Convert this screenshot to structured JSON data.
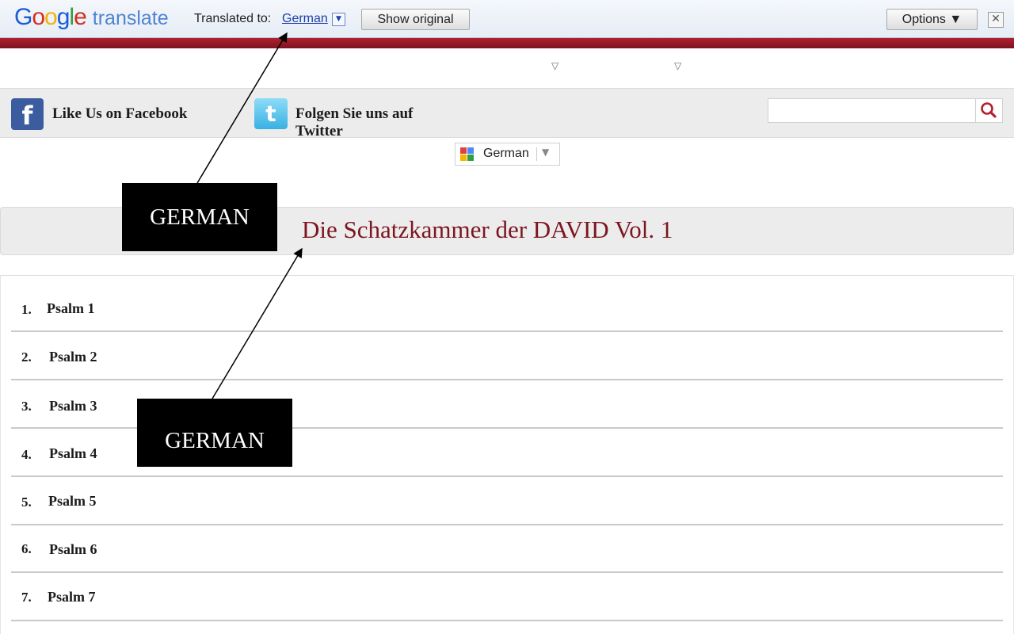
{
  "translate_bar": {
    "logo_google": "Google",
    "logo_translate": "translate",
    "translated_to_label": "Translated to:",
    "language": "German",
    "language_dropdown_glyph": "▼",
    "show_original": "Show original",
    "options": "Options ▼",
    "close_glyph": "✕"
  },
  "nav": {
    "dropdown_glyph": "▽"
  },
  "social": {
    "facebook_label": "Like Us on Facebook",
    "facebook_icon": "facebook-icon",
    "twitter_label": "Folgen Sie uns auf Twitter",
    "twitter_icon": "twitter-icon",
    "search_placeholder": "",
    "search_icon": "search-icon"
  },
  "language_widget": {
    "label": "German",
    "arrow": "▼"
  },
  "page": {
    "title": "Die Schatzkammer der DAVID Vol. 1"
  },
  "psalms": [
    {
      "num": "1.",
      "label": "Psalm 1"
    },
    {
      "num": "2.",
      "label": "Psalm 2"
    },
    {
      "num": "3.",
      "label": "Psalm 3"
    },
    {
      "num": "4.",
      "label": "Psalm 4"
    },
    {
      "num": "5.",
      "label": "Psalm 5"
    },
    {
      "num": "6.",
      "label": "Psalm 6"
    },
    {
      "num": "7.",
      "label": "Psalm 7"
    }
  ],
  "annotations": [
    {
      "text": "GERMAN"
    },
    {
      "text": "GERMAN"
    }
  ],
  "colors": {
    "title": "#7d1520",
    "header_strip": "#9a1a28",
    "link": "#1f3fa8",
    "facebook": "#3b5c9e",
    "twitter": "#37b1e3"
  }
}
